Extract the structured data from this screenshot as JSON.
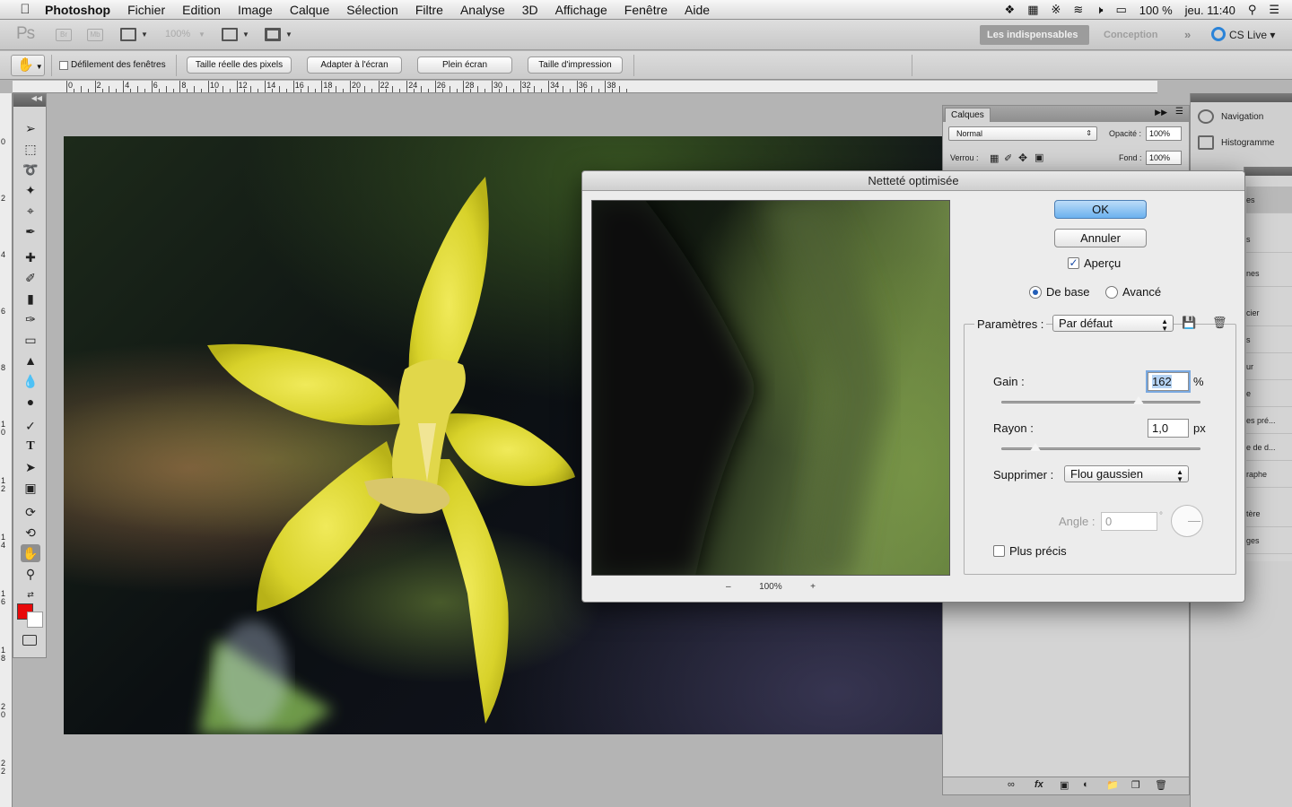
{
  "menubar": {
    "app_name": "Photoshop",
    "items": [
      "Fichier",
      "Edition",
      "Image",
      "Calque",
      "Sélection",
      "Filtre",
      "Analyse",
      "3D",
      "Affichage",
      "Fenêtre",
      "Aide"
    ],
    "battery": "100 %",
    "clock": "jeu. 11:40"
  },
  "appbar": {
    "logo": "Ps",
    "bridge": "Br",
    "minibridge": "Mb",
    "zoom": "100%",
    "workspace_active": "Les indispensables",
    "workspace_other": "Conception",
    "more": "»",
    "cslive": "CS Live"
  },
  "options": {
    "scroll_all": "Défilement des fenêtres",
    "btn_actual": "Taille réelle des pixels",
    "btn_fit": "Adapter à l'écran",
    "btn_fill": "Plein écran",
    "btn_print": "Taille d'impression"
  },
  "ruler": {
    "labels": [
      "0",
      "2",
      "4",
      "6",
      "8",
      "10",
      "12",
      "14",
      "16",
      "18",
      "20",
      "22",
      "24",
      "26",
      "28",
      "30",
      "32",
      "34",
      "36",
      "38"
    ],
    "vlabels": [
      "0",
      "2",
      "4",
      "6",
      "8",
      "1\n0",
      "1\n2",
      "1\n4",
      "1\n6",
      "1\n8",
      "2\n0",
      "2\n2"
    ]
  },
  "layers": {
    "tab": "Calques",
    "blend_mode": "Normal",
    "opacity_label": "Opacité :",
    "opacity": "100%",
    "lock_label": "Verrou :",
    "fill_label": "Fond :",
    "fill": "100%"
  },
  "panel_strip": {
    "navigation": "Navigation",
    "histogram": "Histogramme"
  },
  "side_list": [
    "es",
    "s",
    "nes",
    "cier",
    "s",
    "ur",
    "e",
    "es pré...",
    "e de d...",
    "raphe",
    "tère",
    "ges"
  ],
  "dialog": {
    "title": "Netteté optimisée",
    "ok": "OK",
    "cancel": "Annuler",
    "preview_label": "Aperçu",
    "preview_checked": true,
    "mode_basic": "De base",
    "mode_advanced": "Avancé",
    "mode_selected": "De base",
    "settings_label": "Paramètres :",
    "settings_value": "Par défaut",
    "amount_label": "Gain :",
    "amount_value": "162",
    "amount_unit": "%",
    "amount_fraction": 0.324,
    "radius_label": "Rayon :",
    "radius_value": "1,0",
    "radius_unit": "px",
    "radius_fraction": 0.0016,
    "remove_label": "Supprimer :",
    "remove_value": "Flou gaussien",
    "angle_label": "Angle :",
    "angle_value": "0",
    "angle_unit": "°",
    "more_accurate": "Plus précis",
    "more_accurate_checked": false,
    "zoom_minus": "–",
    "zoom_value": "100%",
    "zoom_plus": "+"
  }
}
